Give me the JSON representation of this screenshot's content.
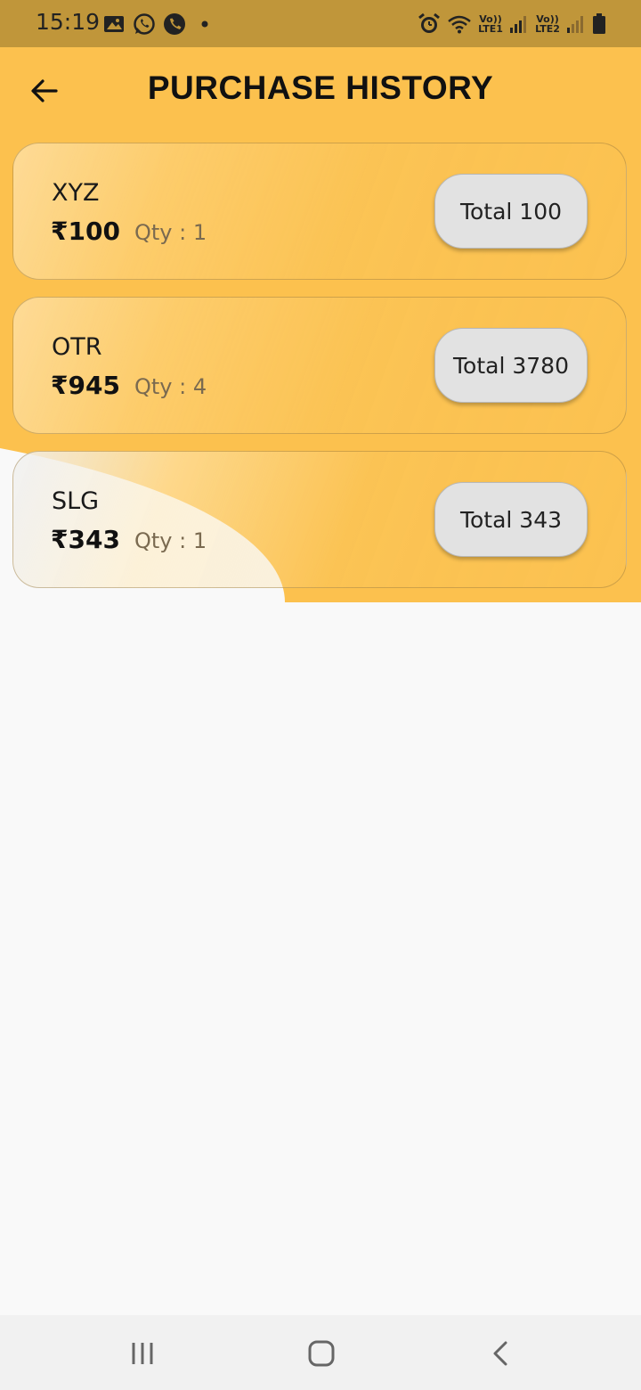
{
  "status_bar": {
    "time": "15:19",
    "sim1_label_top": "Vo))",
    "sim1_label_bottom": "LTE1",
    "sim2_label_top": "Vo))",
    "sim2_label_bottom": "LTE2",
    "icons": [
      "gallery-icon",
      "whatsapp-icon",
      "phone-call-icon",
      "dot-icon",
      "alarm-icon",
      "wifi-icon",
      "signal-icon",
      "battery-icon"
    ]
  },
  "header": {
    "title": "PURCHASE HISTORY",
    "back_icon": "back-arrow-icon"
  },
  "colors": {
    "status_bar": "#c0963a",
    "header_background": "#fcc14e",
    "page_background": "#f9f9f9",
    "total_button": "#e2e2e2"
  },
  "purchases": [
    {
      "name": "XYZ",
      "price": "₹100",
      "qty": "Qty : 1",
      "total": "Total 100"
    },
    {
      "name": "OTR",
      "price": "₹945",
      "qty": "Qty : 4",
      "total": "Total 3780"
    },
    {
      "name": "SLG",
      "price": "₹343",
      "qty": "Qty : 1",
      "total": "Total 343"
    }
  ],
  "nav_bar": {
    "icons": [
      "recent-apps-icon",
      "home-icon",
      "back-icon"
    ]
  }
}
